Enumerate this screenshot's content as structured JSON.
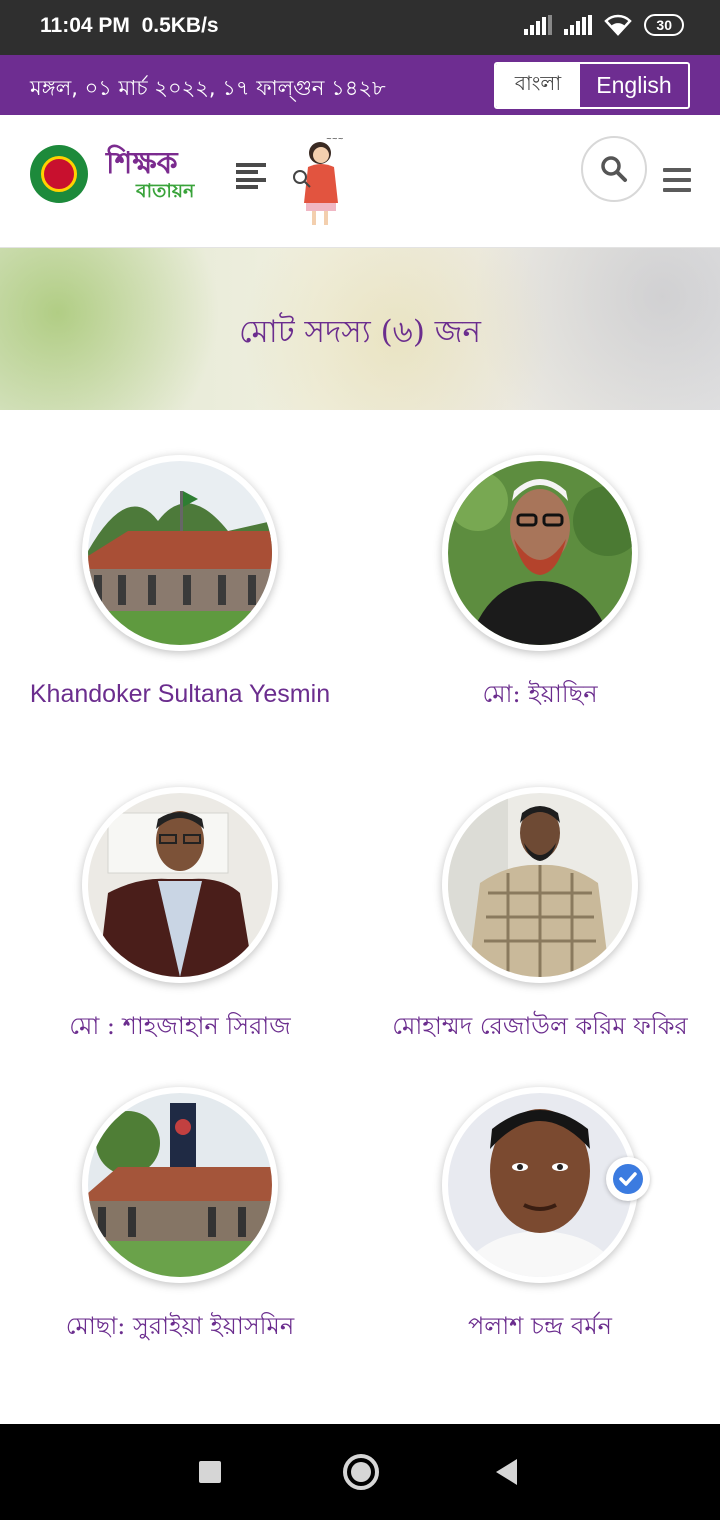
{
  "status_bar": {
    "time": "11:04 PM",
    "speed": "0.5KB/s",
    "battery": "30",
    "icons": [
      "signal-icon",
      "signal-icon",
      "wifi-icon",
      "battery-icon"
    ]
  },
  "top_bar": {
    "date": "মঙ্গল, ০১ মার্চ ২০২২, ১৭ ফাল্গুন ১৪২৮",
    "lang_bangla": "বাংলা",
    "lang_english": "English",
    "accent_color": "#6e2d91"
  },
  "header": {
    "brand_line1": "শিক্ষক",
    "brand_line2": "বাতায়ন",
    "icons": [
      "govt-emblem-icon",
      "menu-icon",
      "mascot-icon",
      "search-icon",
      "hamburger-icon"
    ]
  },
  "banner": {
    "title": "মোট সদস্য (৬) জন"
  },
  "members": [
    {
      "name": "Khandoker Sultana Yesmin",
      "verified": false
    },
    {
      "name": "মো: ইয়াছিন",
      "verified": false
    },
    {
      "name": "মো : শাহজাহান সিরাজ",
      "verified": false
    },
    {
      "name": "মোহাম্মদ রেজাউল করিম ফকির",
      "verified": false
    },
    {
      "name": "মোছা: সুরাইয়া ইয়াসমিন",
      "verified": false
    },
    {
      "name": "পলাশ চন্দ্র বর্মন",
      "verified": true
    }
  ],
  "nav_bar": {
    "icons": [
      "recents-icon",
      "home-icon",
      "back-icon"
    ]
  }
}
